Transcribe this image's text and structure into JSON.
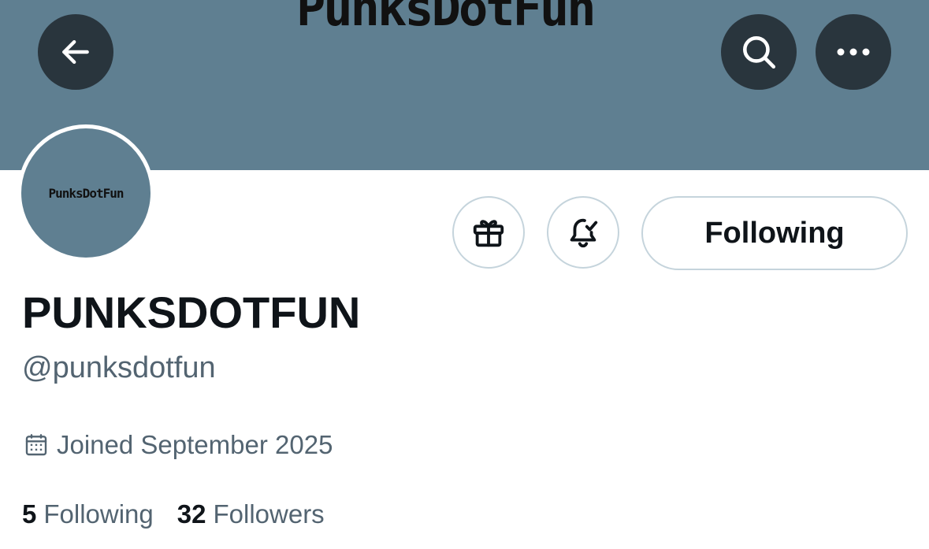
{
  "banner": {
    "logo_text": "PunksDotFun",
    "color": "#5f7f91"
  },
  "top_bar": {
    "back_icon": "arrow-left-icon",
    "search_icon": "search-icon",
    "more_icon": "more-horizontal-icon"
  },
  "profile": {
    "avatar_text": "PunksDotFun",
    "display_name": "PUNKSDOTFUN",
    "handle": "@punksdotfun",
    "joined_icon": "calendar-icon",
    "joined": "Joined September 2025"
  },
  "actions": {
    "gift_icon": "gift-icon",
    "notify_icon": "bell-check-icon",
    "following_label": "Following"
  },
  "stats": {
    "following_count": "5",
    "following_label": "Following",
    "followers_count": "32",
    "followers_label": "Followers"
  }
}
